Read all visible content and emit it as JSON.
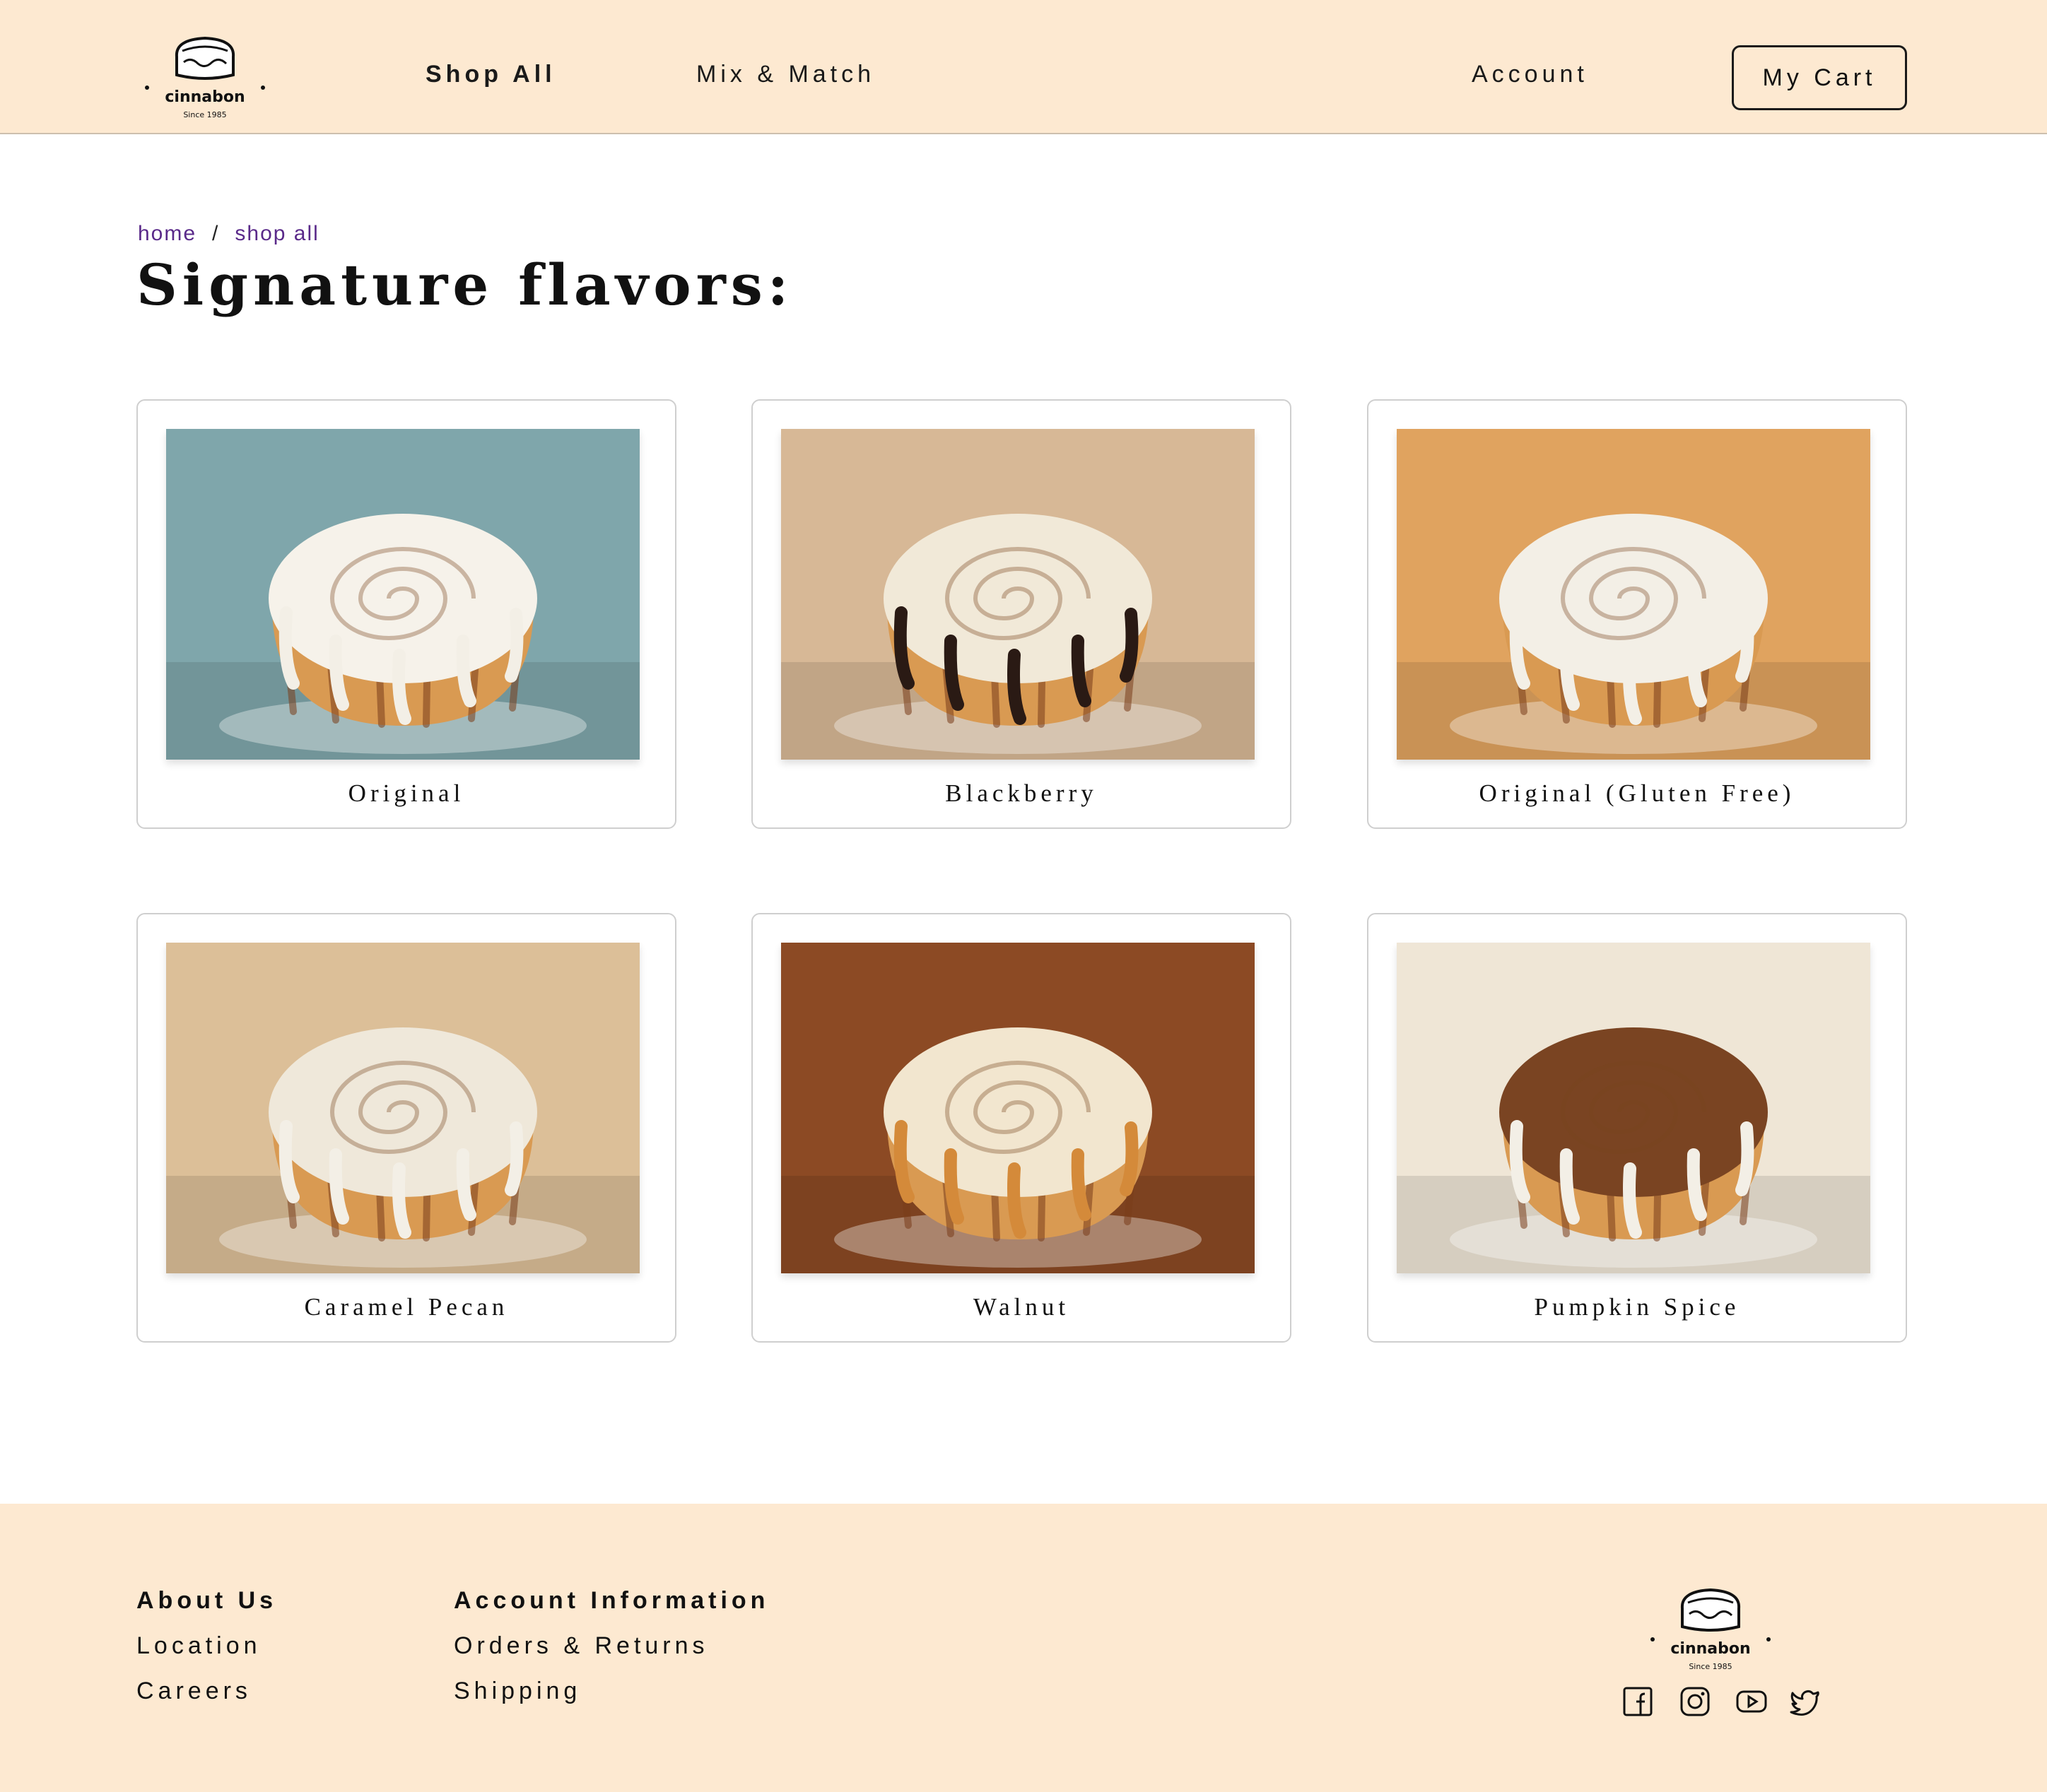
{
  "brand": {
    "logo_text": "cinnabon",
    "logo_tagline": "Since 1985"
  },
  "nav": {
    "shop_all": "Shop All",
    "mix_match": "Mix & Match",
    "account": "Account",
    "cart": "My Cart"
  },
  "breadcrumb": {
    "home": "home",
    "separator": "/",
    "current": "shop all"
  },
  "page_title": "Signature flavors:",
  "products": [
    {
      "name": "Original",
      "drizzle": "#f3efe6",
      "icing": "#f6f2ea",
      "background": "#7fa6ab"
    },
    {
      "name": "Blackberry",
      "drizzle": "#2a1a14",
      "icing": "#f1e9d8",
      "background": "#d7b896"
    },
    {
      "name": "Original (Gluten Free)",
      "drizzle": "#f3efe6",
      "icing": "#f3efe6",
      "background": "#e0a35f"
    },
    {
      "name": "Caramel Pecan",
      "drizzle": "#f3efe6",
      "icing": "#efe8da",
      "background": "#dcbf98"
    },
    {
      "name": "Walnut",
      "drizzle": "#d48a3a",
      "icing": "#f2e6cf",
      "background": "#8c4a24"
    },
    {
      "name": "Pumpkin Spice",
      "drizzle": "#f3efe6",
      "icing": "#7a4422",
      "background": "#efe6d6"
    }
  ],
  "footer": {
    "about_heading": "About Us",
    "location": "Location",
    "careers": "Careers",
    "account_heading": "Account Information",
    "orders_returns": "Orders & Returns",
    "shipping": "Shipping",
    "social_icons": [
      "facebook-icon",
      "instagram-icon",
      "youtube-icon",
      "twitter-icon"
    ]
  },
  "colors": {
    "header_bg": "#fde9d1",
    "breadcrumb_link": "#5a2a8a",
    "text": "#111111"
  }
}
